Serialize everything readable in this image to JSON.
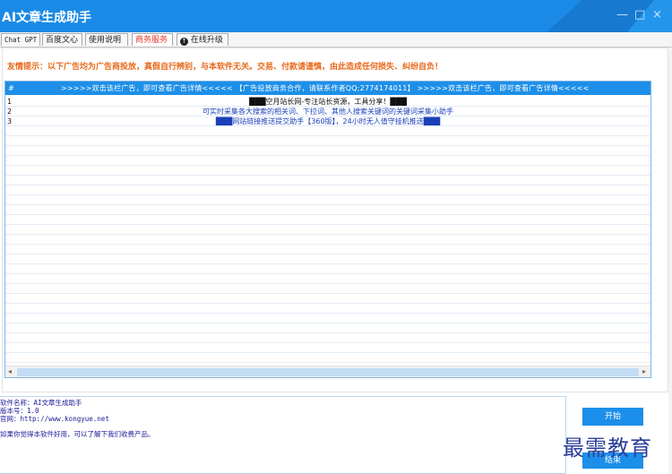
{
  "window": {
    "title": "AI文章生成助手",
    "minimize": "—",
    "maximize": "□",
    "close": "×"
  },
  "tabs": [
    {
      "label": "Chat GPT",
      "active": false
    },
    {
      "label": "百度文心",
      "active": false
    },
    {
      "label": "使用说明",
      "active": false
    },
    {
      "label": "商务服务",
      "active": true
    },
    {
      "label": "在线升级",
      "active": false,
      "icon": "upgrade-icon"
    }
  ],
  "notice": "友情提示：以下广告均为广告商投放，真假自行辨别，与本软件无关。交易、付款请谨慎，由此造成任何损失、纠纷自负！",
  "grid": {
    "header_hash": "#",
    "header_ad": ">>>>>双击该栏广告，即可查看广告详情<<<<<     【广告投放商务合作，请联系作者QQ;2774174011】     >>>>>双击该栏广告，即可查看广告详情<<<<<",
    "rows": [
      {
        "num": "1",
        "text": "███空月站长网-专注站长资源，工具分享！███",
        "color": "#111111"
      },
      {
        "num": "2",
        "text": "可实时采集各大搜索的相关词、下拉词、其他人搜索关键词的关键词采集小助手",
        "color": "#1a3fb8"
      },
      {
        "num": "3",
        "text": "███网站链接推送提交助手【360版】，24小时无人值守挂机推送███",
        "color": "#1a3fb8"
      }
    ]
  },
  "info": {
    "lines": [
      "软件名称：AI文章生成助手",
      "版本号：1.0",
      "官网：http://www.kongyue.net",
      "如果你觉得本软件好用，可以了解下我们收费产品。"
    ]
  },
  "buttons": {
    "start": "开始",
    "second": "结束"
  },
  "watermark": "最需教育",
  "colors": {
    "titlebar": "#1a8ae6",
    "accent": "#1b8fe9",
    "notice": "#e8691b",
    "active_tab": "#e03c2a"
  }
}
